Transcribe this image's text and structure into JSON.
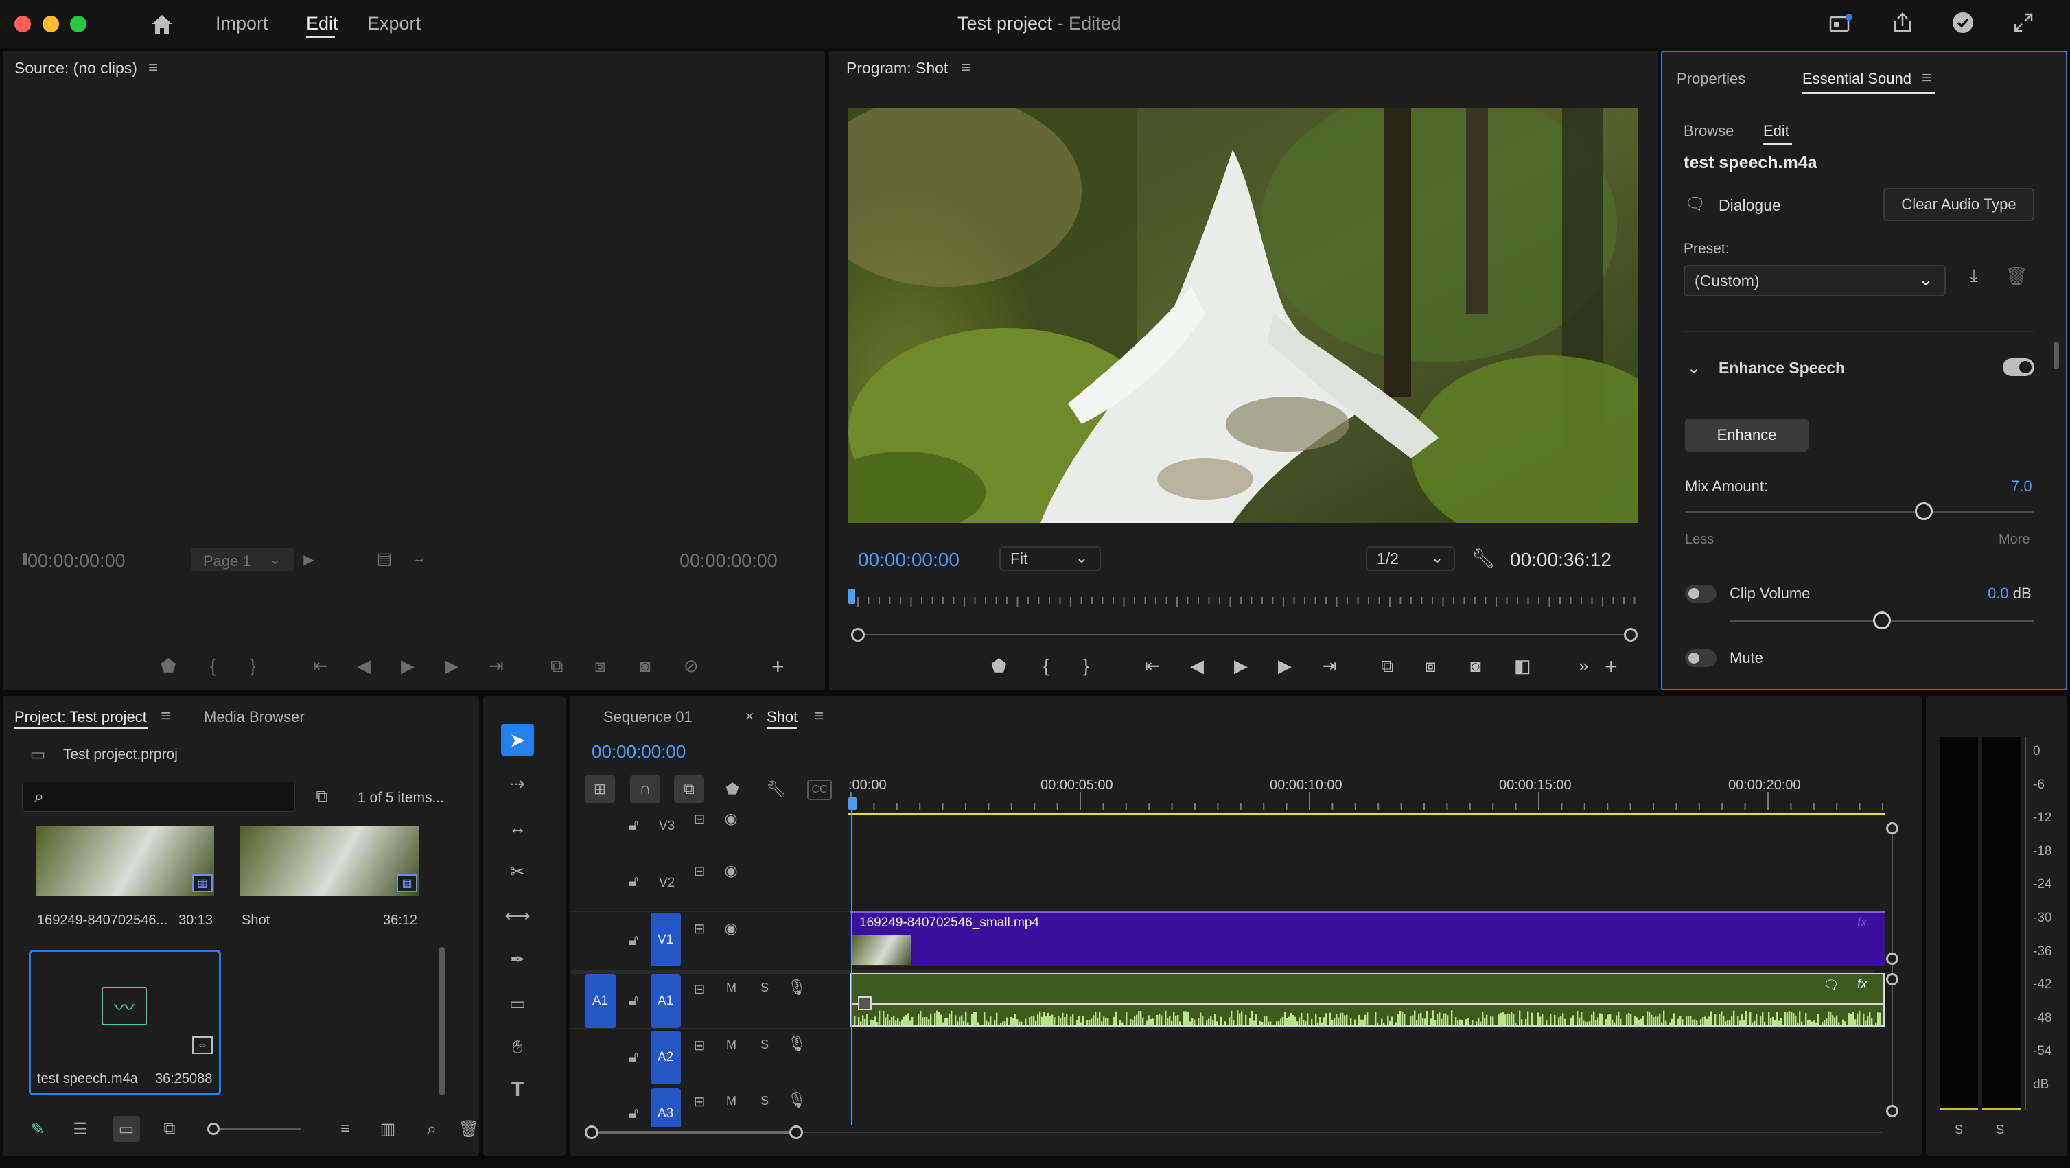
{
  "app": {
    "title": "Test project",
    "title_suffix": " - Edited",
    "menu": [
      "Import",
      "Edit",
      "Export"
    ],
    "active_menu": "Edit"
  },
  "source": {
    "title": "Source: (no clips)",
    "timecode_left": "00:00:00:00",
    "page": "Page 1",
    "timecode_right": "00:00:00:00"
  },
  "program": {
    "title": "Program: Shot",
    "timecode": "00:00:00:00",
    "fit": "Fit",
    "resolution": "1/2",
    "duration": "00:00:36:12"
  },
  "essential_sound": {
    "tabs": [
      "Properties",
      "Essential Sound"
    ],
    "active_tab": "Essential Sound",
    "subtabs": [
      "Browse",
      "Edit"
    ],
    "active_subtab": "Edit",
    "clip_name": "test speech.m4a",
    "audio_type": "Dialogue",
    "clear_btn": "Clear Audio Type",
    "preset_label": "Preset:",
    "preset_value": "(Custom)",
    "section": "Enhance Speech",
    "enhance_btn": "Enhance",
    "mix_label": "Mix Amount:",
    "mix_value": "7.0",
    "mix_level": 0.7,
    "less": "Less",
    "more": "More",
    "clip_volume_label": "Clip Volume",
    "clip_volume_value": "0.0",
    "clip_volume_unit": "dB",
    "mute_label": "Mute",
    "accent": "#2680eb"
  },
  "project": {
    "tabs": [
      "Project: Test project",
      "Media Browser"
    ],
    "file": "Test project.prproj",
    "item_count": "1 of 5 items...",
    "items": [
      {
        "name": "169249-840702546...",
        "dur": "30:13"
      },
      {
        "name": "Shot",
        "dur": "36:12"
      },
      {
        "name": "test speech.m4a",
        "dur": "36:25088"
      }
    ]
  },
  "timeline": {
    "tabs": [
      "Sequence 01",
      "Shot"
    ],
    "active_tab": "Shot",
    "timecode": "00:00:00:00",
    "ruler": [
      ":00:00",
      "00:00:05:00",
      "00:00:10:00",
      "00:00:15:00",
      "00:00:20:00"
    ],
    "video_tracks": [
      "V3",
      "V2",
      "V1"
    ],
    "audio_tracks": [
      "A1",
      "A2",
      "A3"
    ],
    "source_patch": "A1",
    "video_clip": "169249-840702546_small.mp4",
    "track_buttons": {
      "mute": "M",
      "solo": "S"
    },
    "clip_colors": {
      "video": "#3b0f9e",
      "audio": "#3e5a1e"
    }
  },
  "meter": {
    "scale": [
      "0",
      "-6",
      "-12",
      "-18",
      "-24",
      "-30",
      "-36",
      "-42",
      "-48",
      "-54",
      "dB"
    ],
    "channels": [
      "S",
      "S"
    ]
  }
}
